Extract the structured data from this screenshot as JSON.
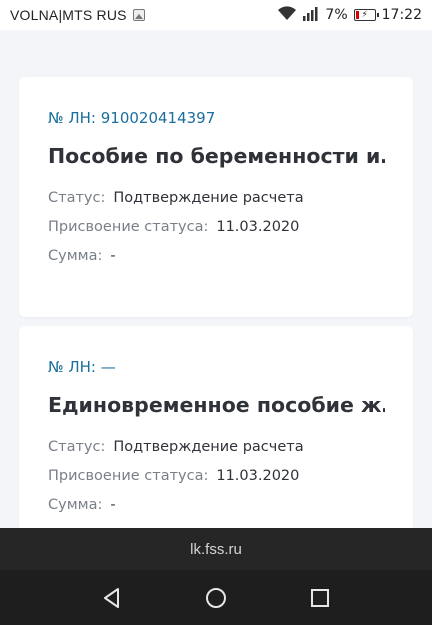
{
  "status_bar": {
    "carrier": "VOLNA|MTS RUS",
    "battery_percent": "7%",
    "time": "17:22",
    "icons": [
      "image-icon",
      "wifi-icon",
      "signal-icon",
      "battery-charging-icon"
    ]
  },
  "cards": [
    {
      "ln_label": "№ ЛН: 910020414397",
      "title": "Пособие по беременности и…",
      "status_key": "Статус:",
      "status_value": "Подтверждение расчета",
      "assign_key": "Присвоение статуса:",
      "assign_value": "11.03.2020",
      "sum_key": "Сумма:",
      "sum_value": "-"
    },
    {
      "ln_label": "№ ЛН: —",
      "title": "Единовременное пособие ж…",
      "status_key": "Статус:",
      "status_value": "Подтверждение расчета",
      "assign_key": "Присвоение статуса:",
      "assign_value": "11.03.2020",
      "sum_key": "Сумма:",
      "sum_value": "-"
    }
  ],
  "browser": {
    "url": "lk.fss.ru"
  },
  "nav": {
    "icons": [
      "back-icon",
      "home-icon",
      "recents-icon"
    ]
  },
  "colors": {
    "accent_link": "#1b6f9e",
    "background": "#f3f5f9",
    "card": "#ffffff"
  }
}
